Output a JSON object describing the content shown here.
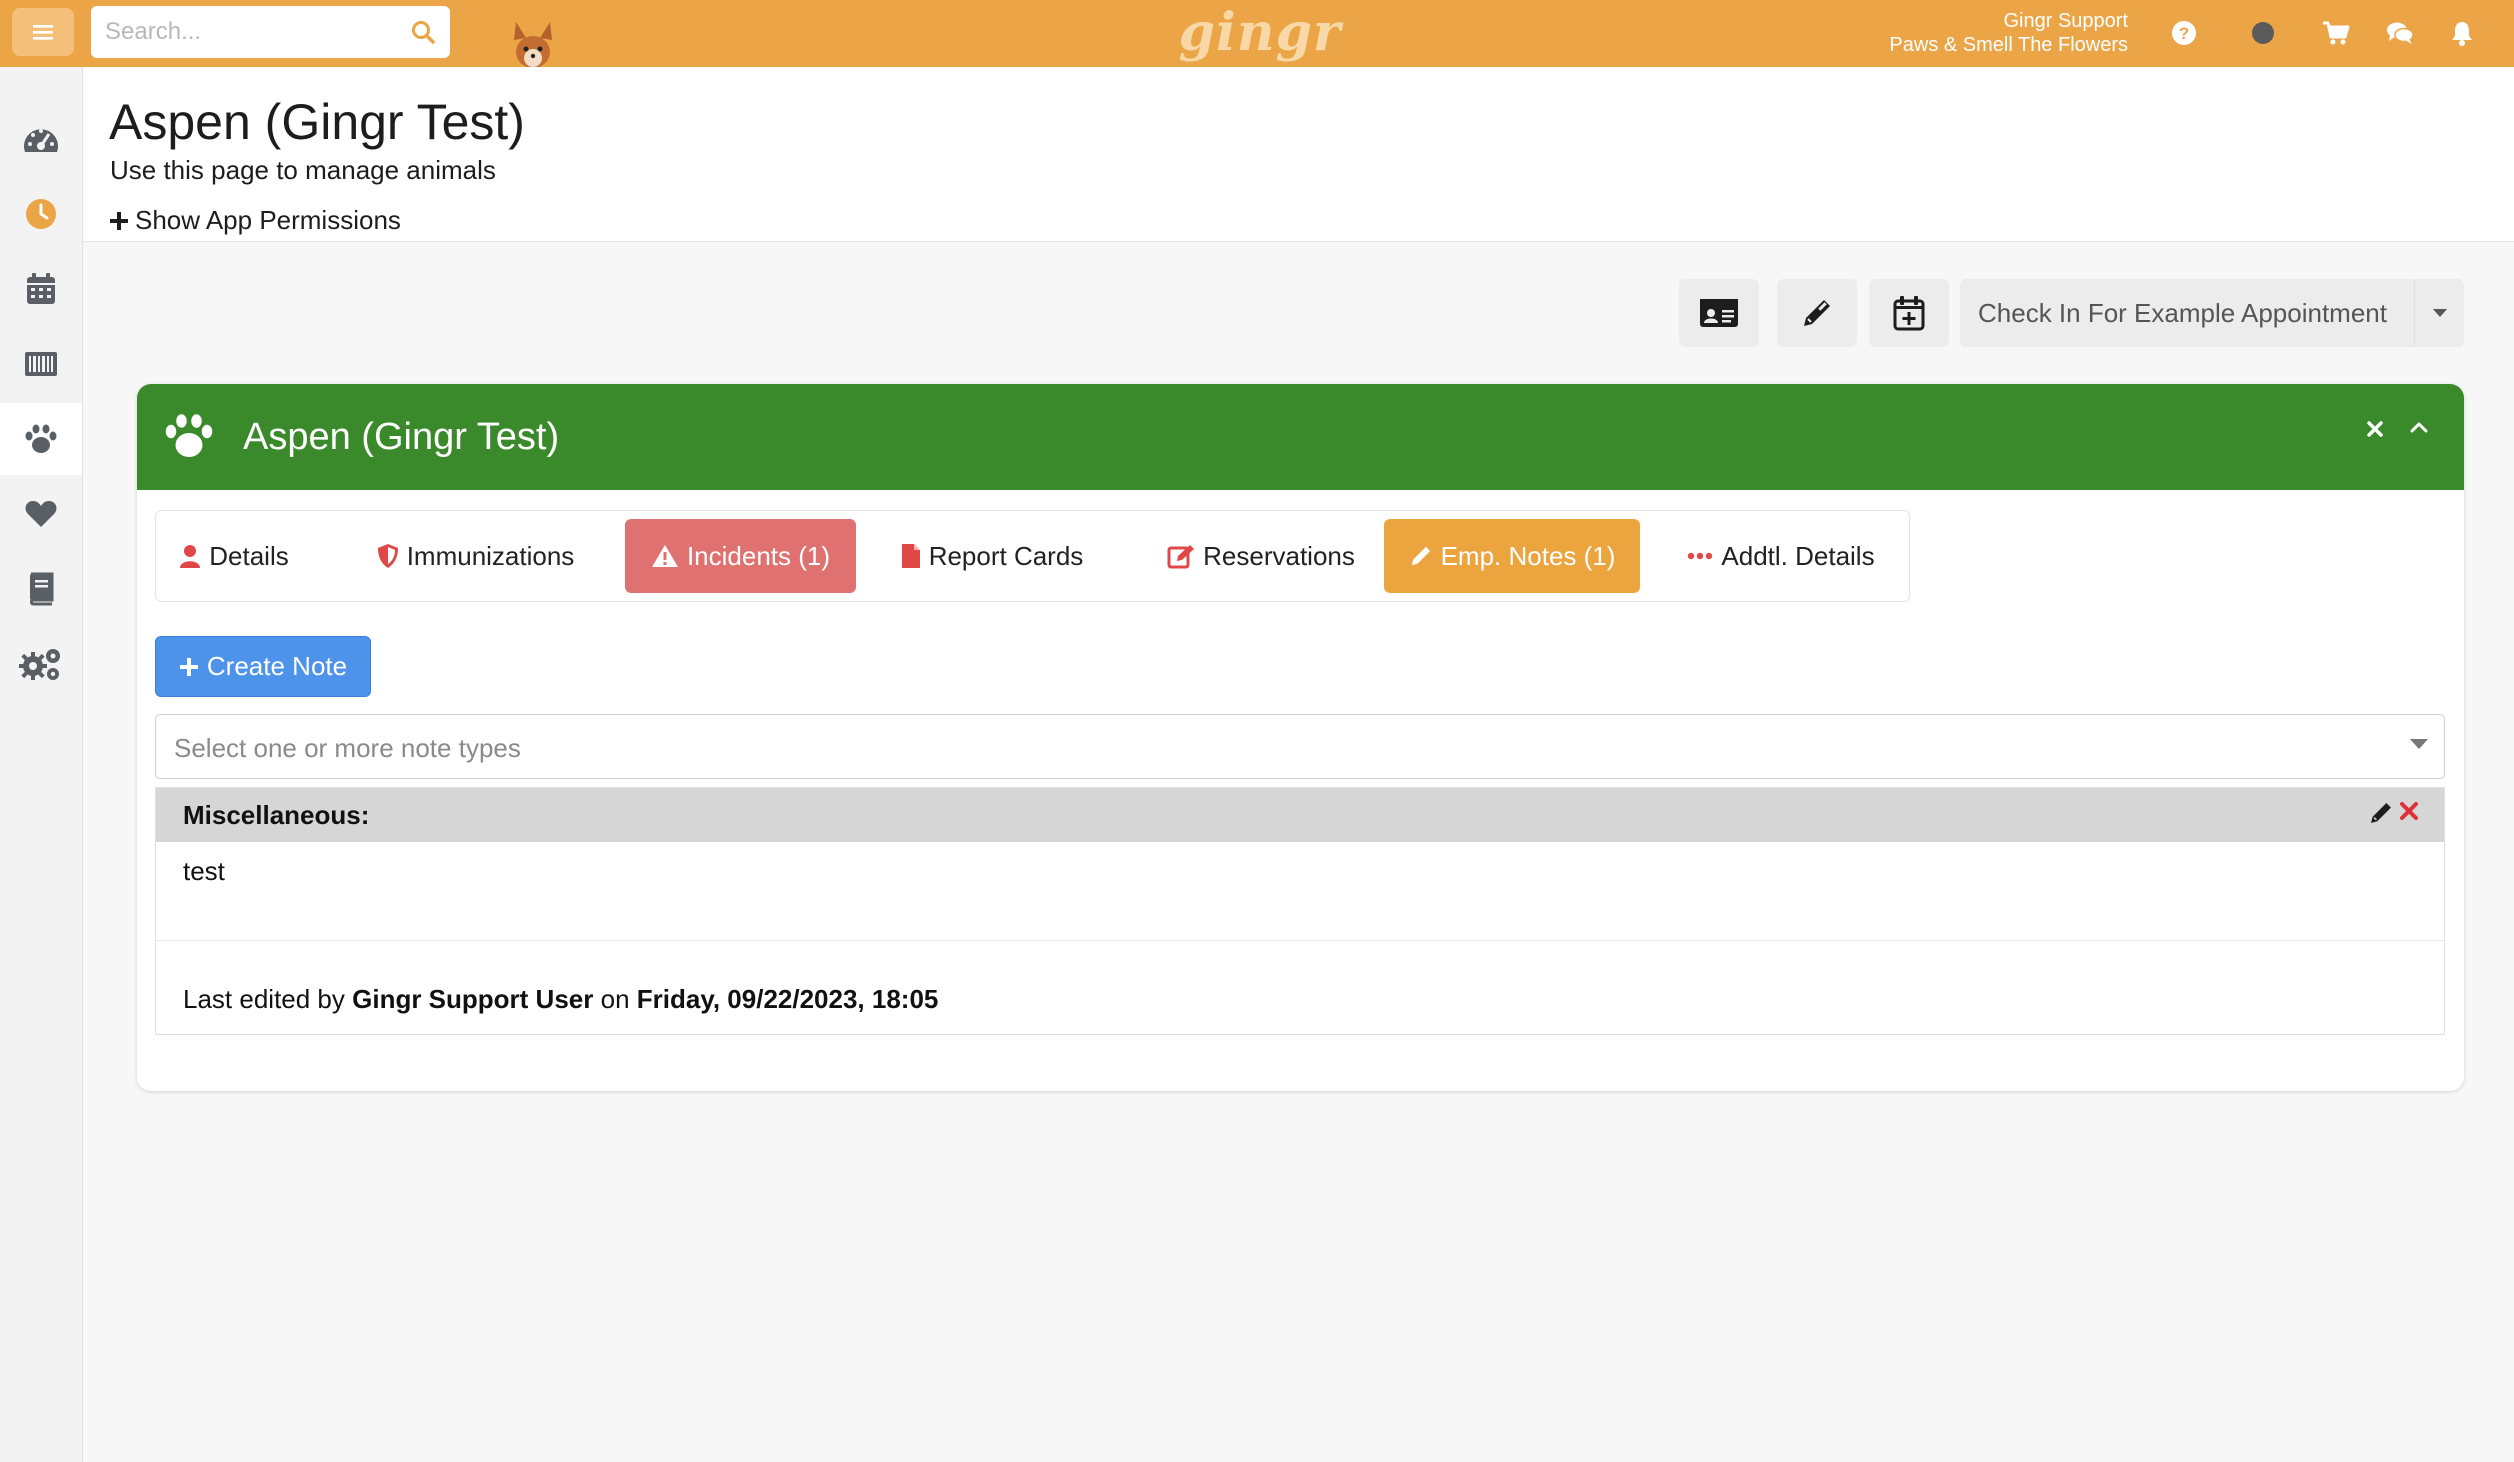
{
  "topbar": {
    "search_placeholder": "Search...",
    "logo_text": "gingr",
    "user_name": "Gingr Support",
    "business_name": "Paws & Smell The Flowers",
    "brand_color": "#eba547"
  },
  "sidebar": {
    "items": [
      {
        "icon": "dashboard-icon"
      },
      {
        "icon": "clock-icon"
      },
      {
        "icon": "calendar-icon"
      },
      {
        "icon": "barcode-icon"
      },
      {
        "icon": "paw-icon",
        "active": true
      },
      {
        "icon": "heart-icon"
      },
      {
        "icon": "book-icon"
      },
      {
        "icon": "settings-icon"
      }
    ]
  },
  "header": {
    "title": "Aspen (Gingr Test)",
    "subtitle": "Use this page to manage animals",
    "permissions_toggle": "Show App Permissions"
  },
  "toolbar": {
    "checkin_label": "Check In For Example Appointment"
  },
  "panel": {
    "title": "Aspen (Gingr Test)",
    "header_color": "#3a8a2b",
    "tabs": [
      {
        "label": "Details",
        "icon": "user-icon"
      },
      {
        "label": "Immunizations",
        "icon": "shield-icon"
      },
      {
        "label": "Incidents (1)",
        "icon": "warning-icon"
      },
      {
        "label": "Report Cards",
        "icon": "file-icon"
      },
      {
        "label": "Reservations",
        "icon": "edit-square-icon"
      },
      {
        "label": "Emp. Notes (1)",
        "icon": "pencil-icon"
      },
      {
        "label": "Addtl. Details",
        "icon": "ellipsis-icon"
      }
    ],
    "create_note_label": "Create Note",
    "note_type_placeholder": "Select one or more note types",
    "note": {
      "type_label": "Miscellaneous:",
      "body": "test",
      "meta_prefix": "Last edited by",
      "meta_user": "Gingr Support User",
      "meta_on": "on",
      "meta_date": "Friday, 09/22/2023, 18:05"
    }
  }
}
